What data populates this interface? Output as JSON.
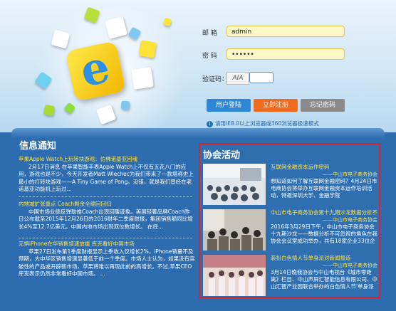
{
  "login": {
    "account_label": "邮  箱",
    "account_value": "admin",
    "password_label": "密  码",
    "password_value": "••••••",
    "captcha_label": "验证码：",
    "captcha_image_text": "AIA",
    "buttons": {
      "login": "用户登陆",
      "register": "立即注册",
      "forgot": "忘记密码"
    },
    "notice": "请用IE8.0以上浏览器或360浏览器极速模式",
    "colors": {
      "login_btn": "#2e87d6",
      "register_btn": "#f06a1f",
      "forgot_btn": "#8a8a8a"
    }
  },
  "info_section": {
    "title": "信息通知",
    "items": [
      {
        "headline": "苹果Apple Watch上玩转块游戏：仿佛诺基亚回魂",
        "body": "2月17日消息 在苹果智能手表Apple Watch上不仅有五花八门的应用，游戏也是不少，今天开发者Matt Wiechec为我们带来了一款堪称史上最小的打转块游戏——A Tiny Game of Pong。没错，就是我们曾经在老诺基亚功能机上玩过..."
      },
      {
        "headline": "内地减扩张重点 Coach剩余全缩回回归",
        "body": "中国市场业绩反弹助推Coach出现回暖迹象。美国轻奢品牌Coach昨日公布截至2015年12月26日的2016财年二季度财报，集团销售额同比增长4%至12.7亿美元。中国内地市场出现双位数增长。    在经..."
      },
      {
        "headline": "无惧iPhone在华销售增速放缓 库克看好中国市场",
        "body": "苹果27日发布第1季度财报显示上季收入仅增长2%，iPhone销量不及预期，大中华区销售增速显著低于前一个季度。市场人士认为，如果没有突破性的产品或开辟新市场，苹果将难以再现此前的高增长。不过,苹果CEO库克表示仍然非常看好中国市场。 ..."
      }
    ]
  },
  "activity_section": {
    "title": "协会活动",
    "items": [
      {
        "headline": "互联网金融资本运作密码",
        "source": "——中山市电子商务协会",
        "body": "想知道如何了解互联网金融密码？4月24日市电商协会将举办互联网金融资本运作培训活动，特邀深圳大学、金融学院",
        "photo_palette": [
          "#dfe5ea",
          "#a8b4bf",
          "#44505e"
        ]
      },
      {
        "headline": "中山市电子商务协会第十九期沙龙数据分析不...",
        "source": "——中山市电子商务协会",
        "body": "2016年3月29日下午，中山市电子商务协会十九期沙龙——数据分析不可忽视的角色在我协会会议室成功举办，共有18家企业33位企业代",
        "photo_palette": [
          "#c8c4bd",
          "#6b6258",
          "#2d2a28"
        ]
      },
      {
        "headline": "装扮白色情人节单身派对新闻报道",
        "source": "——中山市电子商务协会",
        "body": "3月14日晚我协会与中山电视台《城市零距离》栏目、中山声屏汇智能信息有限公司、中山汇智产业园联合举办的白色情人节'单身派对'",
        "photo_palette": [
          "#e8d8d0",
          "#c77f86",
          "#5b4048"
        ]
      }
    ]
  },
  "icons": [
    "info-icon",
    "e-logo-icon"
  ]
}
